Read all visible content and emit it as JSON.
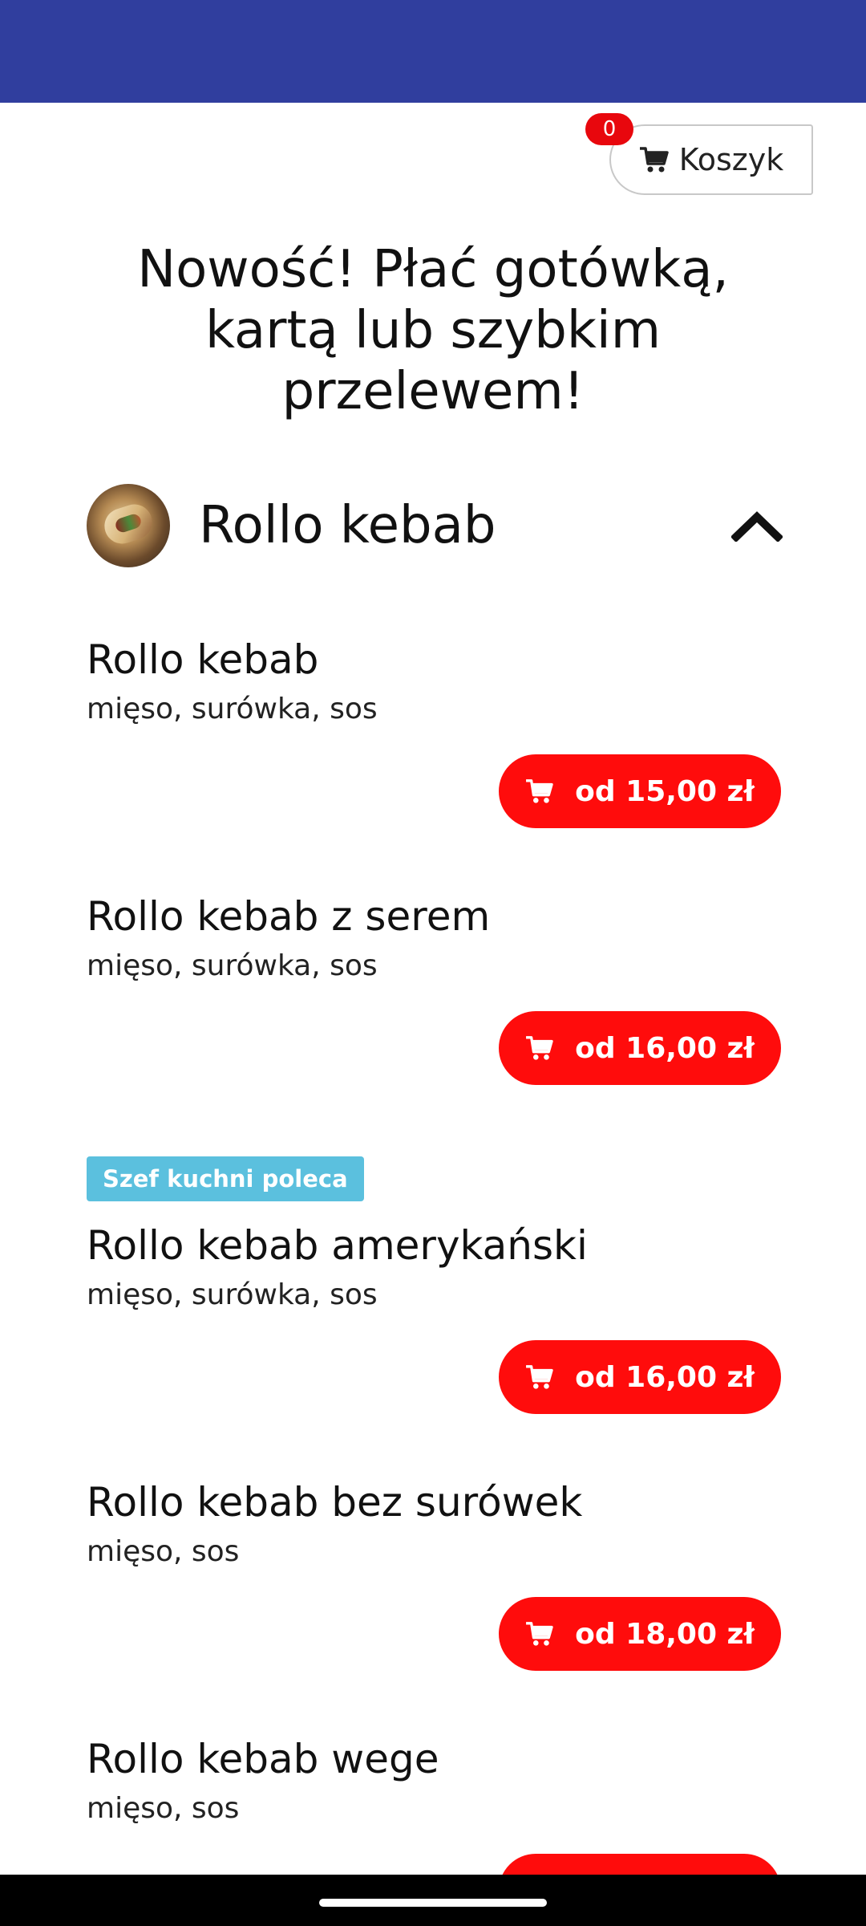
{
  "cart": {
    "count": "0",
    "label": "Koszyk"
  },
  "headline": "Nowość! Płać gotówką, kartą lub szybkim przelewem!",
  "category": {
    "title": "Rollo kebab",
    "expanded": true
  },
  "products": [
    {
      "name": "Rollo kebab",
      "description": "mięso, surówka, sos",
      "price": "od 15,00 zł"
    },
    {
      "name": "Rollo kebab z serem",
      "description": "mięso, surówka, sos",
      "price": "od 16,00 zł"
    },
    {
      "badge": "Szef kuchni poleca",
      "name": "Rollo kebab amerykański",
      "description": "mięso, surówka, sos",
      "price": "od 16,00 zł"
    },
    {
      "name": "Rollo kebab bez surówek",
      "description": "mięso, sos",
      "price": "od 18,00 zł"
    },
    {
      "name": "Rollo kebab wege",
      "description": "mięso, sos"
    }
  ],
  "icons": {
    "cart": "cart-icon",
    "chevron": "chevron-up-icon"
  },
  "colors": {
    "top_bar": "#303e9e",
    "accent_red": "#ff0c0c",
    "badge_blue": "#5bc0de"
  }
}
